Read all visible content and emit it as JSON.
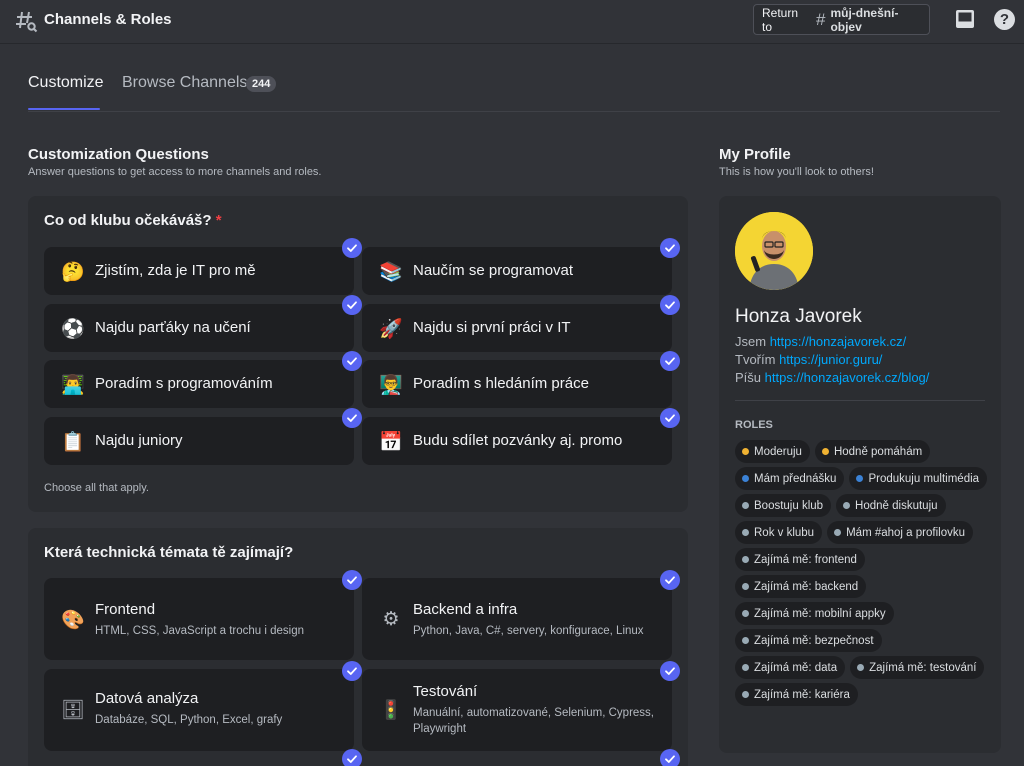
{
  "header": {
    "title": "Channels & Roles",
    "return_label": "Return to",
    "return_channel": "můj-dnešní-objev",
    "help": "?"
  },
  "tabs": [
    {
      "label": "Customize",
      "selected": true
    },
    {
      "label": "Browse Channels",
      "badge": "244",
      "selected": false
    }
  ],
  "customization": {
    "title": "Customization Questions",
    "subtitle": "Answer questions to get access to more channels and roles."
  },
  "questions": [
    {
      "title": "Co od klubu očekáváš?",
      "required_mark": "*",
      "hint": "Choose all that apply.",
      "options": [
        {
          "emoji": "🤔",
          "label": "Zjistím, zda je IT pro mě",
          "checked": true
        },
        {
          "emoji": "📚",
          "label": "Naučím se programovat",
          "checked": true
        },
        {
          "emoji": "⚽",
          "label": "Najdu parťáky na učení",
          "checked": true
        },
        {
          "emoji": "🚀",
          "label": "Najdu si první práci v IT",
          "checked": true
        },
        {
          "emoji": "👨‍💻",
          "label": "Poradím s programováním",
          "checked": true
        },
        {
          "emoji": "👨‍🏫",
          "label": "Poradím s hledáním práce",
          "checked": true
        },
        {
          "emoji": "📋",
          "label": "Najdu juniory",
          "checked": true
        },
        {
          "emoji": "📅",
          "label": "Budu sdílet pozvánky aj. promo",
          "checked": true
        }
      ]
    },
    {
      "title": "Která technická témata tě zajímají?",
      "options": [
        {
          "emoji": "🎨",
          "label": "Frontend",
          "desc": "HTML, CSS, JavaScript a trochu i design",
          "checked": true
        },
        {
          "emoji": "⚙",
          "label": "Backend a infra",
          "desc": "Python, Java, C#, servery, konfigurace, Linux",
          "checked": true
        },
        {
          "emoji": "🗄",
          "label": "Datová analýza",
          "desc": "Databáze, SQL, Python, Excel, grafy",
          "checked": true
        },
        {
          "emoji": "🚦",
          "label": "Testování",
          "desc": "Manuální, automatizované, Selenium, Cypress, Playwright",
          "checked": true
        }
      ]
    }
  ],
  "profile": {
    "title": "My Profile",
    "subtitle": "This is how you'll look to others!",
    "name": "Honza Javorek",
    "bio": [
      {
        "prefix": "Jsem",
        "link": "https://honzajavorek.cz/"
      },
      {
        "prefix": "Tvořím",
        "link": "https://junior.guru/"
      },
      {
        "prefix": "Píšu",
        "link": "https://honzajavorek.cz/blog/"
      }
    ],
    "roles_heading": "ROLES",
    "roles": [
      {
        "label": "Moderuju",
        "color": "#f0b232"
      },
      {
        "label": "Hodně pomáhám",
        "color": "#f0b232"
      },
      {
        "label": "Mám přednášku",
        "color": "#3b82d6"
      },
      {
        "label": "Produkuju multimédia",
        "color": "#3b82d6"
      },
      {
        "label": "Boostuju klub",
        "color": "#99aab5"
      },
      {
        "label": "Hodně diskutuju",
        "color": "#99aab5"
      },
      {
        "label": "Rok v klubu",
        "color": "#99aab5"
      },
      {
        "label": "Mám #ahoj a profilovku",
        "color": "#99aab5"
      },
      {
        "label": "Zajímá mě: frontend",
        "color": "#99aab5"
      },
      {
        "label": "Zajímá mě: backend",
        "color": "#99aab5"
      },
      {
        "label": "Zajímá mě: mobilní appky",
        "color": "#99aab5"
      },
      {
        "label": "Zajímá mě: bezpečnost",
        "color": "#99aab5"
      },
      {
        "label": "Zajímá mě: data",
        "color": "#99aab5"
      },
      {
        "label": "Zajímá mě: testování",
        "color": "#99aab5"
      },
      {
        "label": "Zajímá mě: kariéra",
        "color": "#99aab5"
      }
    ]
  },
  "colors": {
    "accent": "#5865f2",
    "link": "#00a8fc",
    "background": "#313338",
    "card": "#2b2d31",
    "option": "#1e1f22"
  }
}
